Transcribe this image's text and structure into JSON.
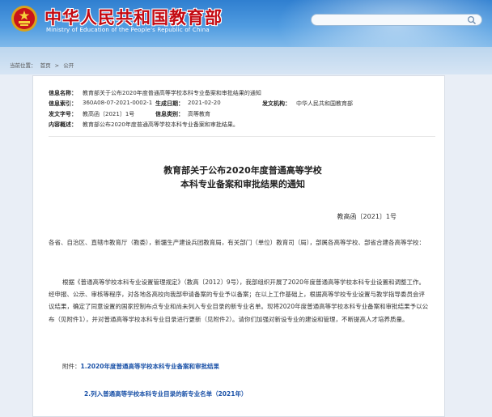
{
  "header": {
    "title": "中华人民共和国教育部",
    "subtitle": "Ministry of Education of the People's Republic of China",
    "search_placeholder": ""
  },
  "breadcrumb": {
    "prefix": "当前位置：",
    "items": [
      "首页",
      "公开"
    ],
    "separator": ">"
  },
  "meta": {
    "name_label": "信息名称：",
    "name_value": "教育部关于公布2020年度普通高等学校本科专业备案和审批结果的通知",
    "index_label": "信息索引：",
    "index_value": "360A08-07-2021-0002-1",
    "date_label": "生成日期：",
    "date_value": "2021-02-20",
    "issuer_label": "发文机构：",
    "issuer_value": "中华人民共和国教育部",
    "docno_label": "发文字号：",
    "docno_value": "教高函〔2021〕1号",
    "category_label": "信息类别：",
    "category_value": "高等教育",
    "summary_label": "内容概述：",
    "summary_value": "教育部公布2020年度普通高等学校本科专业备案和审批结果。"
  },
  "document": {
    "title_line1": "教育部关于公布2020年度普通高等学校",
    "title_line2": "本科专业备案和审批结果的通知",
    "number": "教高函〔2021〕1号",
    "recipients": "各省、自治区、直辖市教育厅（教委），新疆生产建设兵团教育局，有关部门（单位）教育司（局），部属各高等学校、部省合建各高等学校：",
    "body": "根据《普通高等学校本科专业设置管理规定》（教高〔2012〕9号），我部组织开展了2020年度普通高等学校本科专业设置和调整工作。经申报、公示、审核等程序，对各地各高校向我部申请备案的专业予以备案；在以上工作基础上，根据高等学校专业设置与教学指导委员会评议结果，确定了同意设置的国家控制布点专业和尚未列入专业目录的新专业名单。现将2020年度普通高等学校本科专业备案和审批结果予以公布（见附件1），并对普通高等学校本科专业目录进行更新（见附件2）。请你们加强对新设专业的建设和管理，不断提高人才培养质量。",
    "attachments_lead": "附件：",
    "attachment1": "1.2020年度普通高等学校本科专业备案和审批结果",
    "attachment2": "2.列入普通高等学校本科专业目录的新专业名单（2021年）"
  },
  "colors": {
    "title_red": "#c40a12",
    "link_blue": "#1b52a8",
    "banner_blue": "#2f7fd0"
  }
}
